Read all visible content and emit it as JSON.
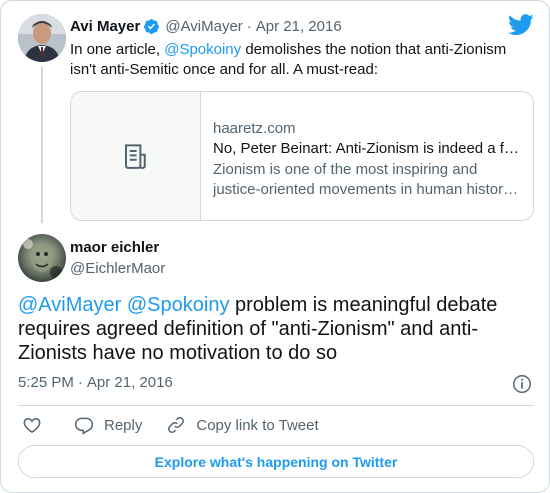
{
  "parent_tweet": {
    "author_name": "Avi Mayer",
    "author_handle": "@AviMayer",
    "separator": "·",
    "date": "Apr 21, 2016",
    "text_before": "In one article, ",
    "mention": "@Spokoiny",
    "text_after": " demolishes the notion that anti-Zionism isn't anti-Semitic once and for all. A must-read:",
    "verified_icon": "verified-badge-icon",
    "brand_icon": "twitter-bird-icon",
    "card": {
      "domain": "haaretz.com",
      "title": "No, Peter Beinart: Anti-Zionism is indeed a form of anti-Semitism",
      "description": "Zionism is one of the most inspiring and justice-oriented movements in human history, and anti-Zionists seek to destroy it.",
      "thumb_icon": "article-icon"
    }
  },
  "main_tweet": {
    "author_name": "maor eichler",
    "author_handle": "@EichlerMaor",
    "mention_1": "@AviMayer",
    "mention_2": "@Spokoiny",
    "text": " problem is meaningful debate requires agreed definition of \"anti-Zionism\" and anti-Zionists have no motivation to do so",
    "time": "5:25 PM",
    "separator": "·",
    "date": "Apr 21, 2016"
  },
  "actions": {
    "reply_label": "Reply",
    "copy_label": "Copy link to Tweet"
  },
  "explore_label": "Explore what's happening on Twitter",
  "colors": {
    "accent": "#1d9bf0",
    "text": "#0f1419",
    "muted": "#536471",
    "border": "#cfd9de"
  }
}
